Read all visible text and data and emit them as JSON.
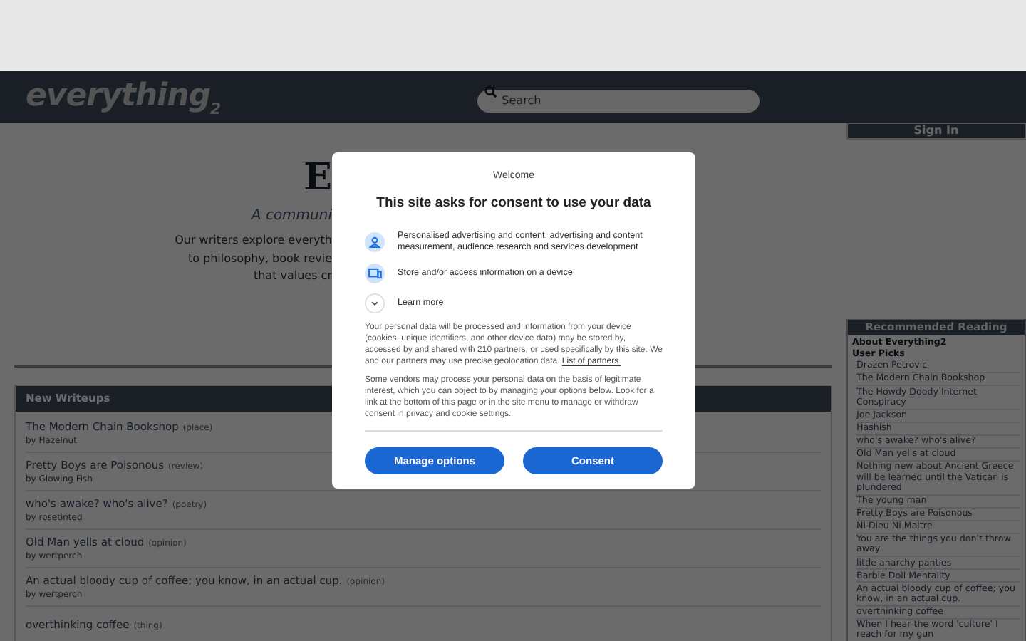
{
  "header": {
    "logo": "everything",
    "logo_sub": "2",
    "search": {
      "placeholder": "Search"
    }
  },
  "intro": {
    "heading": "E",
    "subtitle": "A communi",
    "lines": [
      "Our writers explore everyth",
      "to philosophy, book revie",
      "that values cr"
    ]
  },
  "new_writeups": {
    "title": "New Writeups",
    "items": [
      {
        "title": "The Modern Chain Bookshop",
        "type": "(place)",
        "author": "by Hazelnut"
      },
      {
        "title": "Pretty Boys are Poisonous",
        "type": "(review)",
        "author": "by Glowing Fish"
      },
      {
        "title": "who's awake? who's alive?",
        "type": "(poetry)",
        "author": "by rosetinted"
      },
      {
        "title": "Old Man yells at cloud",
        "type": "(opinion)",
        "author": "by wertperch"
      },
      {
        "title": "An actual bloody cup of coffee; you know, in an actual cup.",
        "type": "(opinion)",
        "author": "by wertperch"
      },
      {
        "title": "overthinking coffee",
        "type": "(thing)"
      }
    ]
  },
  "sidebar": {
    "sign_in": "Sign In",
    "recommended": {
      "title": "Recommended Reading",
      "headings": [
        "About Everything2",
        "User Picks"
      ],
      "picks": [
        "Drazen Petrovic",
        "The Modern Chain Bookshop",
        "The Howdy Doody Internet Conspiracy",
        "Joe Jackson",
        "Hashish",
        "who's awake? who's alive?",
        "Old Man yells at cloud",
        "Nothing new about Ancient Greece will be learned until the Vatican is plundered",
        "The young man",
        "Pretty Boys are Poisonous",
        "Ni Dieu Ni Maitre",
        "You are the things you don't throw away",
        "little anarchy panties",
        "Barbie Doll Mentality",
        "An actual bloody cup of coffee; you know, in an actual cup.",
        "overthinking coffee",
        "When I hear the word 'culture' I reach for my gun"
      ]
    }
  },
  "consent": {
    "welcome": "Welcome",
    "title": "This site asks for consent to use your data",
    "purposes": [
      {
        "kind": "person",
        "text": "Personalised advertising and content, advertising and content measurement, audience research and services development"
      },
      {
        "kind": "device",
        "text": "Store and/or access information on a device"
      }
    ],
    "learn_more": "Learn more",
    "notice": {
      "text": "Your personal data will be processed and information from your device (cookies, unique identifiers, and other device data) may be stored by, accessed by and shared with 210 partners, or used specifically by this site. We and our partners may use precise geolocation data.",
      "link": "List of partners."
    },
    "notice_2": "Some vendors may process your personal data on the basis of legitimate interest, which you can object to by managing your options below. Look for a link at the bottom of this page or in the site menu to manage or withdraw consent in privacy and cookie settings.",
    "buttons": [
      "Manage options",
      "Consent"
    ]
  }
}
